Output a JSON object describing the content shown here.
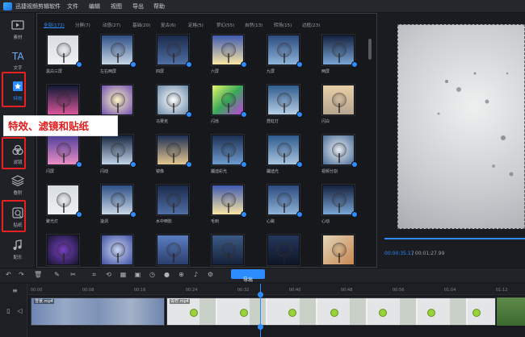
{
  "app": {
    "title": "迅捷视频剪辑软件"
  },
  "menu": [
    "文件",
    "编辑",
    "视图",
    "导出",
    "帮助"
  ],
  "sidebar": [
    {
      "label": "素材",
      "icon": "media-icon"
    },
    {
      "label": "文字",
      "icon": "text-icon"
    },
    {
      "label": "特效",
      "icon": "effects-icon"
    },
    {
      "label": "滤镜",
      "icon": "filter-icon"
    },
    {
      "label": "叠附",
      "icon": "overlay-icon"
    },
    {
      "label": "贴纸",
      "icon": "sticker-icon"
    },
    {
      "label": "配乐",
      "icon": "music-icon"
    }
  ],
  "tabs": [
    {
      "label": "全部(172)",
      "active": true
    },
    {
      "label": "分屏(7)"
    },
    {
      "label": "动感(27)"
    },
    {
      "label": "基础(20)"
    },
    {
      "label": "复古(6)"
    },
    {
      "label": "定格(5)"
    },
    {
      "label": "梦幻(55)"
    },
    {
      "label": "自然(13)"
    },
    {
      "label": "转场(15)"
    },
    {
      "label": "边框(23)"
    }
  ],
  "effects": [
    {
      "label": "黑白三屏",
      "dl": true
    },
    {
      "label": "左右两屏",
      "dl": true
    },
    {
      "label": "四屏",
      "dl": true
    },
    {
      "label": "六屏",
      "dl": true
    },
    {
      "label": "九屏",
      "dl": true
    },
    {
      "label": "两屏",
      "dl": true
    },
    {
      "label": "",
      "dl": false
    },
    {
      "label": "",
      "dl": false
    },
    {
      "label": "马赛克",
      "dl": true
    },
    {
      "label": "闪烁",
      "dl": true
    },
    {
      "label": "霓虹灯",
      "dl": true
    },
    {
      "label": "闪白",
      "dl": false
    },
    {
      "label": "闪屏",
      "dl": true
    },
    {
      "label": "闪动",
      "dl": true
    },
    {
      "label": "镜像",
      "dl": true
    },
    {
      "label": "蹦迪彩光",
      "dl": true
    },
    {
      "label": "蹦迪光",
      "dl": true
    },
    {
      "label": "视频分割",
      "dl": true
    },
    {
      "label": "聚光灯",
      "dl": true
    },
    {
      "label": "漩涡",
      "dl": true
    },
    {
      "label": "水中倒影",
      "dl": false
    },
    {
      "label": "毛刺",
      "dl": true
    },
    {
      "label": "心跳",
      "dl": true
    },
    {
      "label": "心动",
      "dl": true
    },
    {
      "label": "",
      "dl": false
    },
    {
      "label": "",
      "dl": false
    },
    {
      "label": "",
      "dl": false
    },
    {
      "label": "",
      "dl": false
    },
    {
      "label": "",
      "dl": false
    },
    {
      "label": "",
      "dl": false
    }
  ],
  "callout": "特效、滤镜和贴纸",
  "preview": {
    "current_time": "00:00:35.17",
    "total_time": "/ 00:01:27.99"
  },
  "toolbar": {
    "export_label": "导出"
  },
  "timeline": {
    "ticks": [
      "00:00",
      "00:08",
      "00:16",
      "00:24",
      "00:32",
      "00:40",
      "00:48",
      "00:56",
      "01:04",
      "01:12"
    ],
    "clips": [
      {
        "name": "雪景.mp4"
      },
      {
        "name": "青柠.mp4"
      },
      {
        "name": ""
      }
    ]
  },
  "colors": {
    "accent": "#2d8cff",
    "highlight": "#e82020"
  }
}
